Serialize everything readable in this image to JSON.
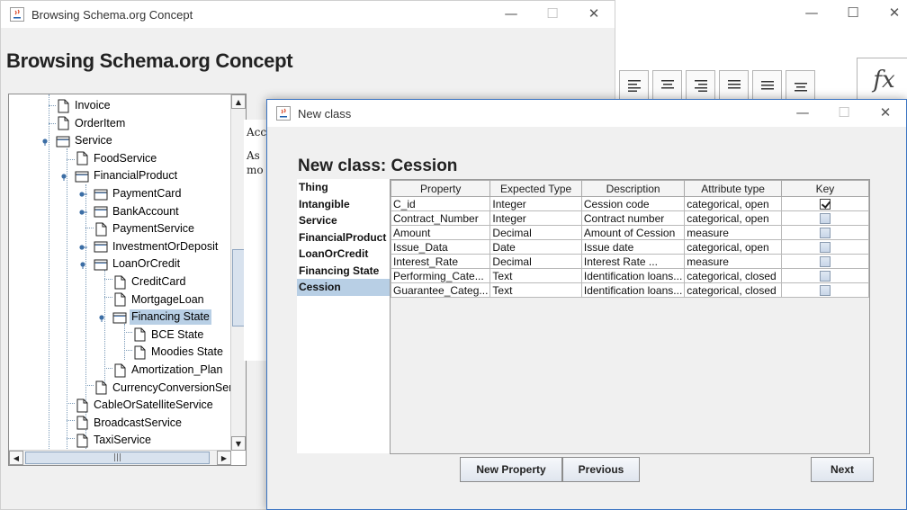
{
  "browse_window": {
    "title": "Browsing Schema.org Concept",
    "heading": "Browsing Schema.org Concept",
    "controls": {
      "minimize": "—",
      "maximize": "☐",
      "close": "✕"
    },
    "tree": [
      {
        "label": "Invoice",
        "type": "leaf",
        "level": 1
      },
      {
        "label": "OrderItem",
        "type": "leaf",
        "level": 1
      },
      {
        "label": "Service",
        "type": "folder",
        "level": 1
      },
      {
        "label": "FoodService",
        "type": "leaf",
        "level": 2
      },
      {
        "label": "FinancialProduct",
        "type": "folder",
        "level": 2
      },
      {
        "label": "PaymentCard",
        "type": "folder-collapsed",
        "level": 3
      },
      {
        "label": "BankAccount",
        "type": "folder-collapsed",
        "level": 3
      },
      {
        "label": "PaymentService",
        "type": "leaf",
        "level": 3
      },
      {
        "label": "InvestmentOrDeposit",
        "type": "folder-collapsed",
        "level": 3
      },
      {
        "label": "LoanOrCredit",
        "type": "folder",
        "level": 3
      },
      {
        "label": "CreditCard",
        "type": "leaf",
        "level": 4
      },
      {
        "label": "MortgageLoan",
        "type": "leaf",
        "level": 4
      },
      {
        "label": "Financing State",
        "type": "folder",
        "level": 4,
        "selected": true
      },
      {
        "label": "BCE State",
        "type": "leaf",
        "level": 5
      },
      {
        "label": "Moodies State",
        "type": "leaf",
        "level": 5
      },
      {
        "label": "Amortization_Plan",
        "type": "leaf",
        "level": 4
      },
      {
        "label": "CurrencyConversionServ",
        "type": "leaf",
        "level": 3
      },
      {
        "label": "CableOrSatelliteService",
        "type": "leaf",
        "level": 2
      },
      {
        "label": "BroadcastService",
        "type": "leaf",
        "level": 2
      },
      {
        "label": "TaxiService",
        "type": "leaf",
        "level": 2
      }
    ],
    "description_lines": [
      "Acc",
      "",
      "As",
      "mo"
    ],
    "hscroll_grip": "|||"
  },
  "bg_window": {
    "controls": {
      "minimize": "—",
      "maximize": "☐",
      "close": "✕"
    },
    "formula_label": "fx"
  },
  "dialog": {
    "title": "New class",
    "heading": "New class: Cession",
    "controls": {
      "minimize": "—",
      "maximize": "☐",
      "close": "✕"
    },
    "hierarchy": [
      {
        "label": "Thing"
      },
      {
        "label": "Intangible"
      },
      {
        "label": "Service"
      },
      {
        "label": "FinancialProduct"
      },
      {
        "label": "LoanOrCredit"
      },
      {
        "label": "Financing State"
      },
      {
        "label": "Cession",
        "selected": true
      }
    ],
    "table": {
      "headers": [
        "Property",
        "Expected Type",
        "Description",
        "Attribute type",
        "Key"
      ],
      "rows": [
        {
          "property": "C_id",
          "type": "Integer",
          "description": "Cession code",
          "attr": "categorical, open",
          "key": true
        },
        {
          "property": "Contract_Number",
          "type": "Integer",
          "description": "Contract number",
          "attr": "categorical, open",
          "key": false
        },
        {
          "property": "Amount",
          "type": "Decimal",
          "description": "Amount of Cession",
          "attr": "measure",
          "key": false
        },
        {
          "property": "Issue_Data",
          "type": "Date",
          "description": "Issue date",
          "attr": "categorical, open",
          "key": false
        },
        {
          "property": "Interest_Rate",
          "type": "Decimal",
          "description": "Interest Rate ...",
          "attr": "measure",
          "key": false
        },
        {
          "property": "Performing_Cate...",
          "type": "Text",
          "description": "Identification loans...",
          "attr": "categorical, closed",
          "key": false
        },
        {
          "property": "Guarantee_Categ...",
          "type": "Text",
          "description": "Identification loans...",
          "attr": "categorical, closed",
          "key": false
        }
      ]
    },
    "buttons": {
      "new_property": "New Property",
      "previous": "Previous",
      "next": "Next"
    }
  }
}
